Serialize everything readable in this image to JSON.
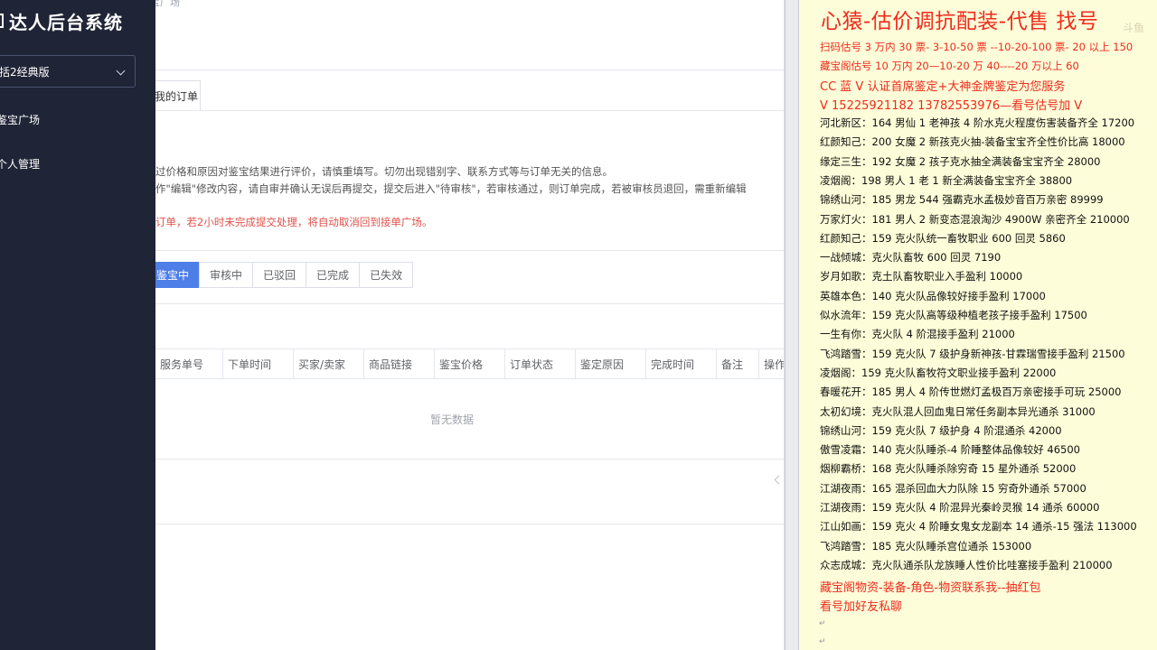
{
  "sidebar": {
    "brand": "达人后台系统",
    "version_select": "括2经典版",
    "nav": [
      {
        "label": "鉴宝广场"
      },
      {
        "label": "个人管理"
      }
    ]
  },
  "main": {
    "breadcrumb": "宝广场",
    "tab": "我的订单",
    "notes": [
      "过价格和原因对鉴宝结果进行评价，请慎重填写。切勿出现错别字、联系方式等与订单无关的信息。",
      "作\"编辑\"修改内容，请自审并确认无误后再提交，提交后进入\"待审核\"，若审核通过，则订单完成，若被审核员退回，需重新编辑",
      "订单，若2小时未完成提交处理，将自动取消回到接单广场。"
    ],
    "status_tabs": [
      "鉴宝中",
      "审核中",
      "已驳回",
      "已完成",
      "已失效"
    ],
    "table_headers": [
      "服务单号",
      "下单时间",
      "买家/卖家",
      "商品链接",
      "鉴宝价格",
      "订单状态",
      "鉴定原因",
      "完成时间",
      "备注",
      "操作"
    ],
    "empty_text": "暂无数据"
  },
  "panel": {
    "title": "心猿-估价调抗配装-代售 找号",
    "watermark": "斗鱼",
    "header_lines": [
      "扫码估号 3 万内 30 票- 3-10-50 票 --10-20-100 票- 20 以上 150",
      "藏宝阁估号 10 万内 20—10-20 万 40----20 万以上 60",
      "CC 蓝 V 认证首席鉴定+大神金牌鉴定为您服务",
      "V 15225921182      13782553976—看号估号加 V"
    ],
    "listings": [
      "河北新区：164 男仙 1 老神孩 4 阶水克火程度伤害装备齐全 17200",
      "红颜知己：200 女魔 2 新孩克火抽-装备宝宝齐全性价比高 18000",
      "缘定三生：192 女魔 2 孩子克水抽全满装备宝宝齐全 28000",
      "凌烟阁：198 男人 1 老 1 新全满装备宝宝齐全 38800",
      "锦绣山河：185 男龙 544 强霸克水孟极妙音百万亲密 89999",
      "万家灯火：181 男人 2 新变态混浪淘沙 4900W 亲密齐全 210000",
      "红颜知己：159 克火队统一畜牧职业 600 回灵 5860",
      "一战倾城：克火队畜牧 600 回灵 7190",
      "岁月如歌：克土队畜牧职业入手盈利 10000",
      "英雄本色：140 克火队品像较好接手盈利 17000",
      "似水流年：159 克火队高等级种植老孩子接手盈利 17500",
      "一生有你：克火队 4 阶混接手盈利 21000",
      "飞鸿踏雪：159 克火队 7 级护身新神孩-甘霖瑞雪接手盈利 21500",
      "凌烟阁：159 克火队畜牧符文职业接手盈利 22000",
      "春暖花开：185 男人 4 阶传世燃灯孟极百万亲密接手可玩 25000",
      "太初幻境：克火队混人回血鬼日常任务副本异光通杀 31000",
      "锦绣山河：159 克火队 7 级护身 4 阶混通杀 42000",
      "傲雪凌霜：140 克火队睡杀-4 阶睡整体品像较好 46500",
      "烟柳霸桥：168 克火队睡杀除穷奇 15 星外通杀 52000",
      "江湖夜雨：165 混杀回血大力队除 15 穷奇外通杀 57000",
      "江湖夜雨：159 克火队 4 阶混异光秦岭灵猴 14 通杀 60000",
      "江山如画：159 克火 4 阶睡女鬼女龙副本 14 通杀-15 强法 113000",
      "飞鸿踏雪：185 克火队睡杀宫位通杀 153000",
      "众志成城：克火队通杀队龙族睡人性价比哇塞接手盈利 210000"
    ],
    "footer_lines": [
      "藏宝阁物资-装备-角色-物资联系我--抽红包",
      "看号加好友私聊"
    ]
  }
}
